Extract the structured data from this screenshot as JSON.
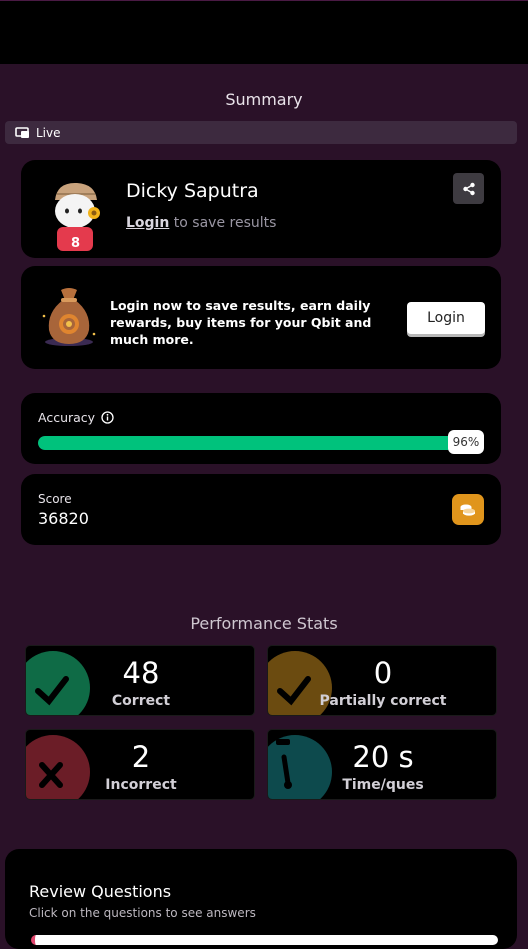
{
  "page": {
    "title": "Summary"
  },
  "mode": {
    "label": "Live",
    "icon": "live-quiz-icon"
  },
  "profile": {
    "name": "Dicky Saputra",
    "login_link": "Login",
    "login_suffix": " to save results",
    "share_icon": "share-icon",
    "avatar_icon": "avatar-icon"
  },
  "promo": {
    "text": "Login now to save results, earn daily rewards, buy items for your Qbit and much more.",
    "button": "Login",
    "icon": "money-bag-icon"
  },
  "accuracy": {
    "label": "Accuracy",
    "value": 0.96,
    "value_label": "96%",
    "info_icon": "info-icon",
    "color": "#00c27c"
  },
  "score": {
    "label": "Score",
    "value": "36820",
    "icon": "coins-icon",
    "color": "#e0951c"
  },
  "performance": {
    "title": "Performance Stats",
    "stats": [
      {
        "value": "48",
        "label": "Correct",
        "icon": "check-icon",
        "color": "#0f6b46"
      },
      {
        "value": "0",
        "label": "Partially correct",
        "icon": "check-icon",
        "color": "#6b4b10"
      },
      {
        "value": "2",
        "label": "Incorrect",
        "icon": "cross-icon",
        "color": "#6b1d27"
      },
      {
        "value": "20 s",
        "label": "Time/ques",
        "icon": "stopwatch-icon",
        "color": "#0d4a4d"
      }
    ]
  },
  "review": {
    "title": "Review Questions",
    "subtitle": "Click on the questions to see answers"
  }
}
